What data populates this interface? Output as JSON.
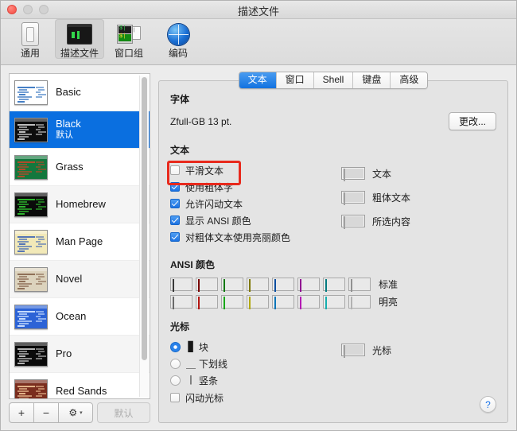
{
  "window": {
    "title": "描述文件",
    "controls": {
      "close": "close",
      "minimize": "minimize",
      "zoom": "zoom"
    }
  },
  "toolbar": {
    "items": [
      {
        "label": "通用",
        "icon": "general-window-icon",
        "active": false
      },
      {
        "label": "描述文件",
        "icon": "terminal-profile-icon",
        "active": true
      },
      {
        "label": "窗口组",
        "icon": "window-group-icon",
        "active": false
      },
      {
        "label": "编码",
        "icon": "globe-encoding-icon",
        "active": false
      }
    ]
  },
  "profiles": {
    "items": [
      {
        "name": "Basic",
        "subtitle": "",
        "bg": "#ffffff",
        "fg": "#3b78c2",
        "selected": false
      },
      {
        "name": "Black",
        "subtitle": "默认",
        "bg": "#0d0d0d",
        "fg": "#c8c8c8",
        "selected": true
      },
      {
        "name": "Grass",
        "subtitle": "",
        "bg": "#13773d",
        "fg": "#b84a2a",
        "selected": false
      },
      {
        "name": "Homebrew",
        "subtitle": "",
        "bg": "#0b0b0b",
        "fg": "#2fbd2f",
        "selected": false
      },
      {
        "name": "Man Page",
        "subtitle": "",
        "bg": "#f2e9b8",
        "fg": "#4c6fb5",
        "selected": false
      },
      {
        "name": "Novel",
        "subtitle": "",
        "bg": "#dcd3bd",
        "fg": "#8a6a52",
        "selected": false
      },
      {
        "name": "Ocean",
        "subtitle": "",
        "bg": "#2c63d6",
        "fg": "#cfe2ff",
        "selected": false
      },
      {
        "name": "Pro",
        "subtitle": "",
        "bg": "#0a0a0a",
        "fg": "#bdbdbd",
        "selected": false
      },
      {
        "name": "Red Sands",
        "subtitle": "",
        "bg": "#7a2d1e",
        "fg": "#e8b98e",
        "selected": false
      }
    ],
    "actions": {
      "add": "+",
      "remove": "−",
      "gear": "⚙",
      "chevron": "▾",
      "default_button": "默认"
    }
  },
  "tabs": [
    {
      "label": "文本",
      "active": true
    },
    {
      "label": "窗口",
      "active": false
    },
    {
      "label": "Shell",
      "active": false
    },
    {
      "label": "键盘",
      "active": false
    },
    {
      "label": "高级",
      "active": false
    }
  ],
  "font_section": {
    "title": "字体",
    "value": "Zfull-GB 13 pt.",
    "change_button": "更改..."
  },
  "text_section": {
    "title": "文本",
    "checkboxes": [
      {
        "label": "平滑文本",
        "checked": false,
        "highlighted": true
      },
      {
        "label": "使用粗体字",
        "checked": true,
        "highlighted": false
      },
      {
        "label": "允许闪动文本",
        "checked": true,
        "highlighted": false
      },
      {
        "label": "显示 ANSI 颜色",
        "checked": true,
        "highlighted": false
      },
      {
        "label": "对粗体文本使用亮丽颜色",
        "checked": true,
        "highlighted": false
      }
    ],
    "color_wells": [
      {
        "label": "文本",
        "color": "#ffffff"
      },
      {
        "label": "粗体文本",
        "color": "#ffffff"
      },
      {
        "label": "所选内容",
        "color": "#46484a"
      }
    ]
  },
  "ansi_section": {
    "title": "ANSI 颜色",
    "rows": [
      {
        "tag": "标准",
        "colors": [
          "#4c4c4c",
          "#a00805",
          "#18a018",
          "#a8a005",
          "#1168d6",
          "#c017c2",
          "#06a5ab",
          "#c2c2c2"
        ]
      },
      {
        "tag": "明亮",
        "colors": [
          "#8e8e8e",
          "#ef1b15",
          "#20e020",
          "#ece115",
          "#0e9cf7",
          "#f125f1",
          "#1de8e8",
          "#eeeeee"
        ]
      }
    ]
  },
  "cursor_section": {
    "title": "光标",
    "radios": [
      {
        "label": "块",
        "glyph": "▉",
        "selected": true
      },
      {
        "label": "下划线",
        "glyph": "＿",
        "selected": false
      },
      {
        "label": "竖条",
        "glyph": "|",
        "selected": false
      }
    ],
    "blink_checkbox": {
      "label": "闪动光标",
      "checked": false
    },
    "color_well": {
      "label": "光标",
      "color": "#46484a"
    }
  },
  "help": {
    "glyph": "?"
  }
}
